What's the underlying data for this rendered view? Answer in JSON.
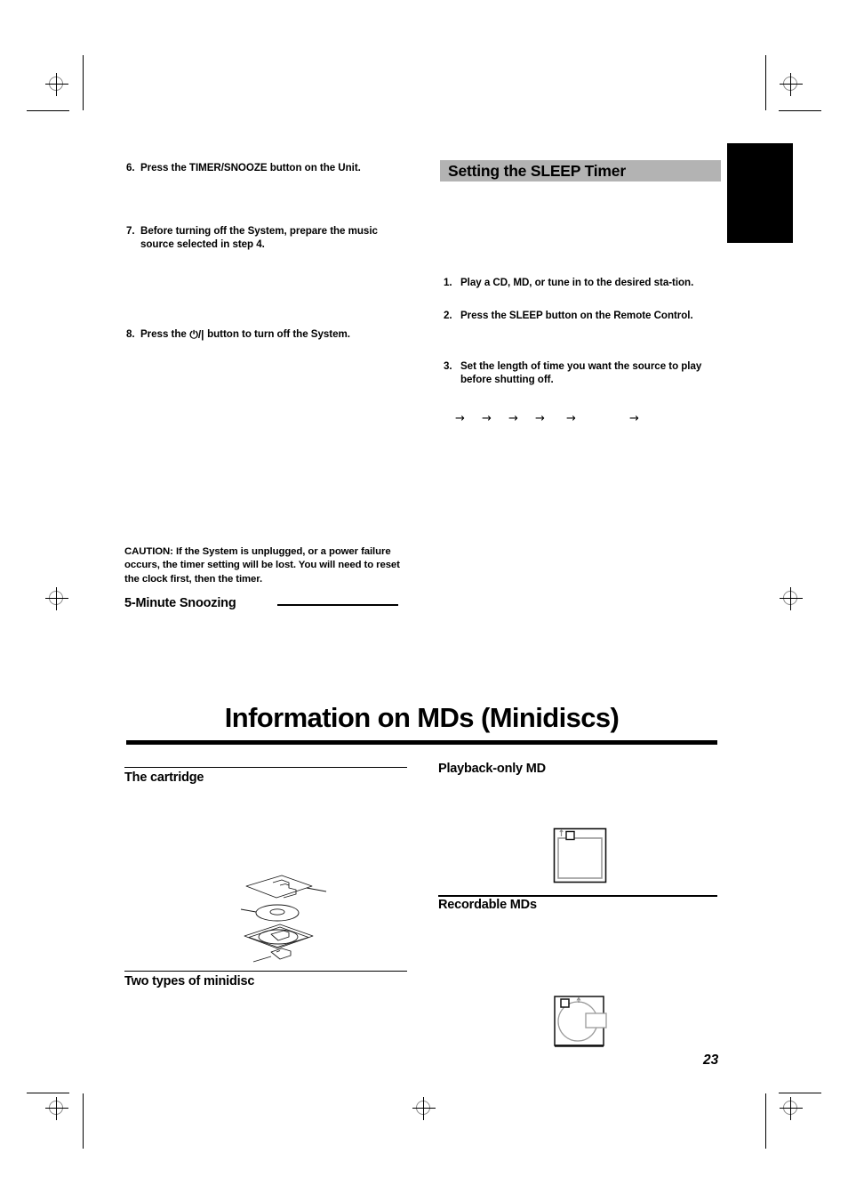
{
  "page": {
    "number": "23",
    "paper_color": "#ffffff"
  },
  "left_column": {
    "steps": [
      {
        "num": "6.",
        "text": "Press the TIMER/SNOOZE button on the Unit."
      },
      {
        "num": "7.",
        "text": "Before turning off the System, prepare the music source selected in step 4."
      }
    ],
    "step_power": {
      "num": "8.",
      "text_before": "Press the",
      "icon": "power-standby-icon",
      "icon_glyph": "⏻/|",
      "text_after": "button to turn off the System."
    },
    "caution": "CAUTION: If the System is unplugged, or a power failure occurs, the timer setting will be lost. You will need to reset the clock first, then the timer.",
    "snooze_heading": "5-Minute Snoozing"
  },
  "right_column": {
    "section_bar": {
      "label": "Setting the SLEEP Timer",
      "background": "#b3b3b3"
    },
    "thumb_tab_color": "#000000",
    "steps": [
      {
        "num": "1.",
        "text": "Play a CD, MD, or tune in to the desired sta-tion."
      },
      {
        "num": "2.",
        "text": "Press the SLEEP button on the Remote Control."
      },
      {
        "num": "3.",
        "text": "Set the length of time you want the source to play before shutting off."
      }
    ],
    "arrow_glyph": "→",
    "arrow_count": 6
  },
  "md_section": {
    "title": "Information on MDs (Minidiscs)",
    "left": {
      "cartridge_heading": "The cartridge",
      "types_heading": "Two types of minidisc",
      "figure_name": "exploded-minidisc-cartridge-diagram"
    },
    "right": {
      "playback_heading": "Playback-only MD",
      "recordable_heading": "Recordable MDs",
      "playback_figure_name": "playback-only-md-cartridge-figure",
      "recordable_figure_name": "recordable-md-cartridge-figure"
    }
  }
}
